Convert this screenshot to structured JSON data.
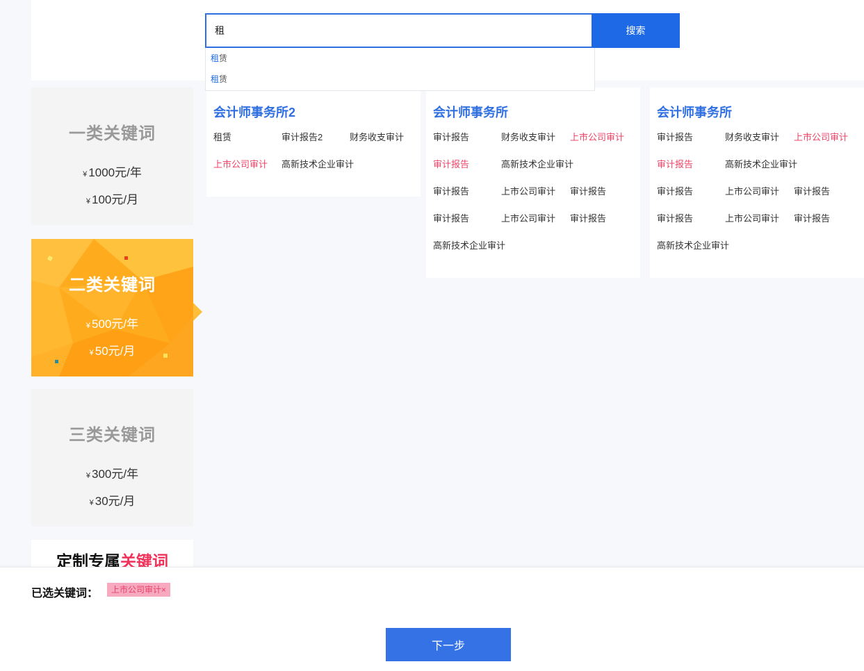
{
  "search": {
    "value": "租",
    "button_label": "搜索",
    "suggestions": [
      {
        "highlight": "租",
        "rest": "赁"
      },
      {
        "highlight": "租",
        "rest": "赁"
      }
    ]
  },
  "tiers": [
    {
      "title": "一类关键词",
      "yen": "¥",
      "price_year": "1000元/年",
      "price_month": "100元/月"
    },
    {
      "title": "二类关键词",
      "yen": "¥",
      "price_year": "500元/年",
      "price_month": "50元/月"
    },
    {
      "title": "三类关键词",
      "yen": "¥",
      "price_year": "300元/年",
      "price_month": "30元/月"
    },
    {
      "title_main": "定制专属",
      "title_accent": "关键词"
    }
  ],
  "cards": [
    {
      "title": "会计师事务所2",
      "keywords": [
        "租赁",
        "审计报告2",
        "财务收支审计",
        "上市公司审计",
        "高新技术企业审计"
      ]
    },
    {
      "title": "会计师事务所",
      "keywords": [
        "审计报告",
        "财务收支审计",
        "上市公司审计",
        "审计报告",
        "高新技术企业审计",
        "审计报告",
        "上市公司审计",
        "审计报告",
        "审计报告",
        "上市公司审计",
        "审计报告",
        "高新技术企业审计"
      ]
    },
    {
      "title": "会计师事务所",
      "keywords": [
        "审计报告",
        "财务收支审计",
        "上市公司审计",
        "审计报告",
        "高新技术企业审计",
        "审计报告",
        "上市公司审计",
        "审计报告",
        "审计报告",
        "上市公司审计",
        "审计报告",
        "高新技术企业审计"
      ]
    }
  ],
  "selected": {
    "label": "已选关键词：",
    "tags": [
      "上市公司审计×"
    ]
  },
  "next_button": "下一步",
  "colors": {
    "accent_blue": "#1e6ae6",
    "selected_red": "#ee4466",
    "tier2_orange": "#ffa91f"
  }
}
